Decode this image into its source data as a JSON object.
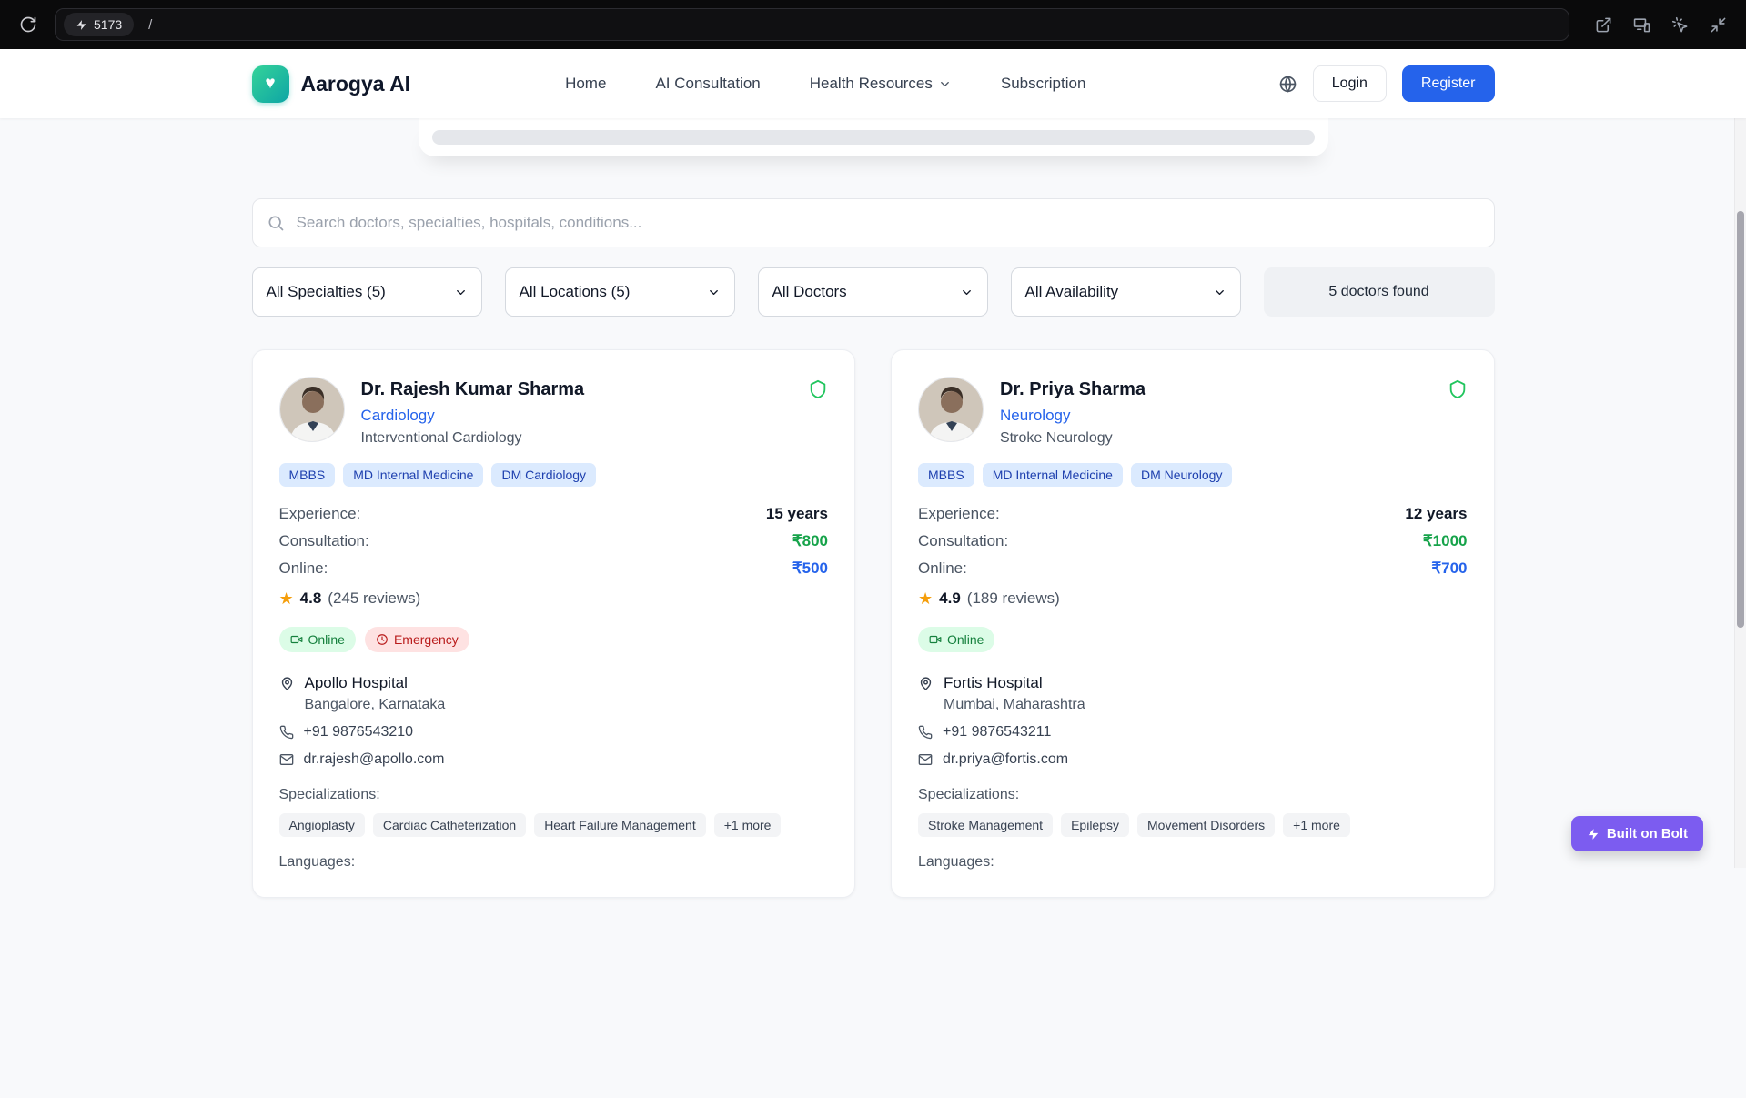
{
  "browser": {
    "port": "5173",
    "path": "/"
  },
  "header": {
    "brand": "Aarogya AI",
    "nav": [
      {
        "label": "Home"
      },
      {
        "label": "AI Consultation"
      },
      {
        "label": "Health Resources"
      },
      {
        "label": "Subscription"
      }
    ],
    "login_label": "Login",
    "register_label": "Register"
  },
  "search": {
    "placeholder": "Search doctors, specialties, hospitals, conditions..."
  },
  "filters": {
    "specialties": "All Specialties (5)",
    "locations": "All Locations (5)",
    "doctors": "All Doctors",
    "availability": "All Availability",
    "results": "5 doctors found"
  },
  "labels": {
    "experience": "Experience:",
    "consultation": "Consultation:",
    "online": "Online:",
    "specializations": "Specializations:",
    "languages": "Languages:"
  },
  "doctors": [
    {
      "name": "Dr. Rajesh Kumar Sharma",
      "specialty": "Cardiology",
      "subspecialty": "Interventional Cardiology",
      "qualifications": [
        "MBBS",
        "MD Internal Medicine",
        "DM Cardiology"
      ],
      "experience": "15 years",
      "consultation_fee": "₹800",
      "online_fee": "₹500",
      "rating": "4.8",
      "reviews": "(245 reviews)",
      "status": [
        "Online",
        "Emergency"
      ],
      "hospital": "Apollo Hospital",
      "location": "Bangalore, Karnataka",
      "phone": "+91 9876543210",
      "email": "dr.rajesh@apollo.com",
      "specializations": [
        "Angioplasty",
        "Cardiac Catheterization",
        "Heart Failure Management"
      ],
      "more": "+1 more"
    },
    {
      "name": "Dr. Priya Sharma",
      "specialty": "Neurology",
      "subspecialty": "Stroke Neurology",
      "qualifications": [
        "MBBS",
        "MD Internal Medicine",
        "DM Neurology"
      ],
      "experience": "12 years",
      "consultation_fee": "₹1000",
      "online_fee": "₹700",
      "rating": "4.9",
      "reviews": "(189 reviews)",
      "status": [
        "Online"
      ],
      "hospital": "Fortis Hospital",
      "location": "Mumbai, Maharashtra",
      "phone": "+91 9876543211",
      "email": "dr.priya@fortis.com",
      "specializations": [
        "Stroke Management",
        "Epilepsy",
        "Movement Disorders"
      ],
      "more": "+1 more"
    }
  ],
  "bolt": {
    "label": "Built on Bolt"
  },
  "colors": {
    "accent_blue": "#2563eb",
    "fee_green": "#16a34a",
    "fee_blue": "#2563eb",
    "verified_green": "#22c55e",
    "bolt_purple": "#7c5cf0",
    "brand_teal": "#14b8a6"
  }
}
